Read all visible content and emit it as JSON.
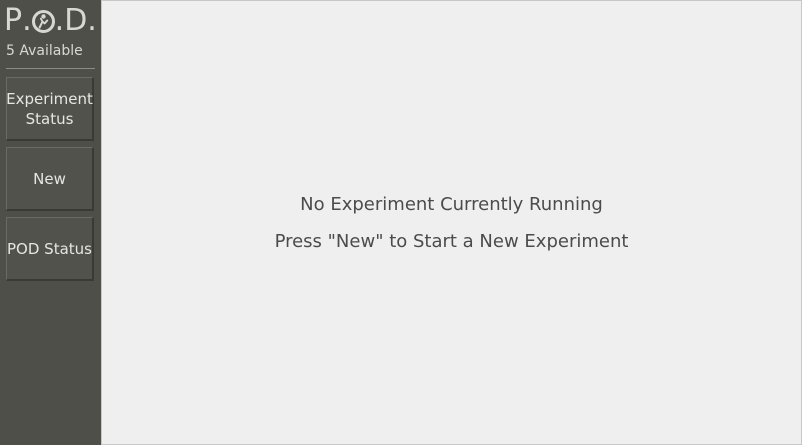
{
  "sidebar": {
    "brand": {
      "p": "P",
      "dot1": ".",
      "d": "D",
      "dot2": "."
    },
    "available": "5 Available",
    "buttons": [
      {
        "label_line1": "Experiment",
        "label_line2": "Status"
      },
      {
        "label": "New"
      },
      {
        "label": "POD Status"
      }
    ]
  },
  "main": {
    "line1": "No Experiment Currently Running",
    "line2": "Press \"New\" to Start a New Experiment"
  },
  "colors": {
    "sidebar_bg": "#4e4f48",
    "content_bg": "#efefef",
    "text_light": "#d7d8d2",
    "text_dark": "#4b4b4b"
  }
}
